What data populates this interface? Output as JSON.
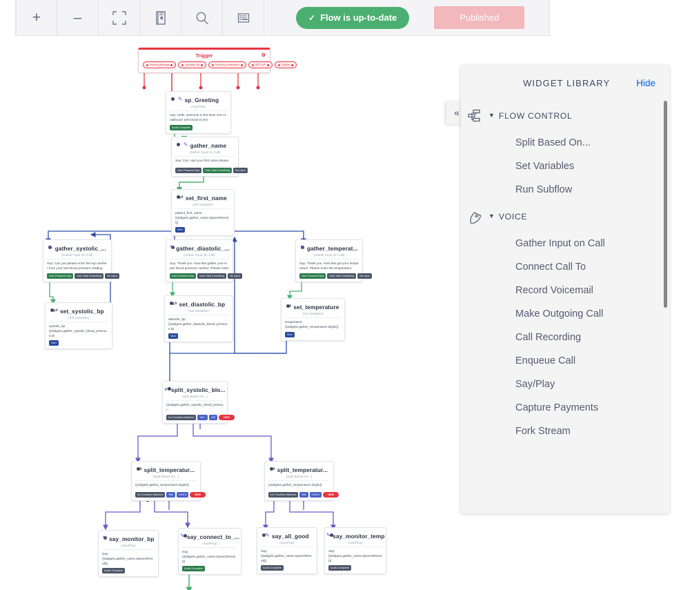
{
  "toolbar": {
    "buttons": [
      {
        "name": "zoom-in-button",
        "glyph": "+"
      },
      {
        "name": "zoom-out-button",
        "glyph": "–"
      },
      {
        "name": "fit-to-screen-button",
        "glyph": "crop"
      },
      {
        "name": "library-toggle-button",
        "glyph": "book"
      },
      {
        "name": "search-button",
        "glyph": "search"
      },
      {
        "name": "grid-button",
        "glyph": "grid"
      }
    ],
    "status_label": "Flow is up-to-date",
    "status_check": "✓",
    "status_color": "#4caf72",
    "publish_label": "Published",
    "publish_color": "#f2b8bc"
  },
  "widget_library": {
    "title": "WIDGET LIBRARY",
    "hide_label": "Hide",
    "collapse_glyph": "«",
    "groups": [
      {
        "label": "FLOW CONTROL",
        "icon": "flow-control-icon",
        "caret": "▼",
        "items": [
          "Split Based On...",
          "Set Variables",
          "Run Subflow"
        ]
      },
      {
        "label": "VOICE",
        "icon": "phone-icon",
        "caret": "▼",
        "items": [
          "Gather Input on Call",
          "Connect Call To",
          "Record Voicemail",
          "Make Outgoing Call",
          "Call Recording",
          "Enqueue Call",
          "Say/Play",
          "Capture Payments",
          "Fork Stream"
        ]
      }
    ]
  },
  "trigger": {
    "title": "Trigger",
    "gear": "⚙",
    "pills": [
      "Incoming Message",
      "Incoming Call",
      "Incoming Conversation",
      "REST API",
      "Subflow"
    ]
  },
  "nodes": [
    {
      "id": "sp_Greeting",
      "title": "sp_Greeting",
      "subtitle": "(Say/Play)",
      "icon": "say-play-icon",
      "body": "Say: Hello, welcome to the Next Gen Healthcare self check-in line",
      "ports": [
        {
          "label": "Audio Complete",
          "color": "green"
        }
      ]
    },
    {
      "id": "gather_name",
      "title": "gather_name",
      "subtitle": "(Gather Input On Call)",
      "icon": "gather-icon",
      "body": "Say: Can I get your first name please",
      "ports": [
        {
          "label": "User Pressed Keys",
          "color": "grey"
        },
        {
          "label": "User Said Something",
          "color": "green"
        },
        {
          "label": "No Input",
          "color": "grey"
        }
      ]
    },
    {
      "id": "set_first_name",
      "title": "set_first_name",
      "subtitle": "(Set Variables)",
      "icon": "set-variables-icon",
      "body": "patient_first_name\n{{widgets.gather_name.SpeechResult}}",
      "ports": [
        {
          "label": "Next",
          "color": "navy"
        }
      ]
    },
    {
      "id": "gather_systolic",
      "title": "gather_systolic_...",
      "subtitle": "(Gather Input On Call)",
      "icon": "gather-icon",
      "body": "Say: Can you please enter the top number from your last blood pressure reading",
      "ports": [
        {
          "label": "User Pressed Keys",
          "color": "green"
        },
        {
          "label": "User Said Something",
          "color": "grey"
        },
        {
          "label": "No Input",
          "color": "grey"
        }
      ]
    },
    {
      "id": "gather_diastolic",
      "title": "gather_diastolic_...",
      "subtitle": "(Gather Input On Call)",
      "icon": "gather-icon",
      "body": "Say: Thank you. Now lets gather your lower blood pressure number. Please enter",
      "ports": [
        {
          "label": "User Pressed Keys",
          "color": "green"
        },
        {
          "label": "User Said Something",
          "color": "grey"
        },
        {
          "label": "No Input",
          "color": "grey"
        }
      ]
    },
    {
      "id": "gather_temperature",
      "title": "gather_temperat...",
      "subtitle": "(Gather Input On Call)",
      "icon": "gather-icon",
      "body": "Say: Thank you. Now lets get your temperature. Please enter the temperature",
      "ports": [
        {
          "label": "User Pressed Keys",
          "color": "green"
        },
        {
          "label": "User Said Something",
          "color": "grey"
        },
        {
          "label": "No Input",
          "color": "grey"
        }
      ]
    },
    {
      "id": "set_systolic_bp",
      "title": "set_systolic_bp",
      "subtitle": "(Set Variables)",
      "icon": "set-variables-icon",
      "body": "systolic_bp\n{{widgets.gather_systolic_blood_pressure.Di",
      "ports": [
        {
          "label": "Next",
          "color": "navy"
        }
      ]
    },
    {
      "id": "set_diastolic_bp",
      "title": "set_diastolic_bp",
      "subtitle": "(Set Variables)",
      "icon": "set-variables-icon",
      "body": "diastolic_bp\n{{widgets.gather_diastolic_blood_pressure.Di",
      "ports": [
        {
          "label": "Next",
          "color": "navy"
        }
      ]
    },
    {
      "id": "set_temperature",
      "title": "set_temperature",
      "subtitle": "(Set Variables)",
      "icon": "set-variables-icon",
      "body": "temperature\n{{widgets.gather_temperature.Digits}}",
      "ports": [
        {
          "label": "Next",
          "color": "navy"
        }
      ]
    },
    {
      "id": "split_systolic",
      "title": "split_systolic_blo...",
      "subtitle": "(Split Based On...)",
      "icon": "split-icon",
      "body": "{{widgets.gather_systolic_blood_pressur...",
      "ports": [
        {
          "label": "No Condition Matches",
          "color": "grey"
        },
        {
          "label": "120..",
          "color": "blue"
        },
        {
          "label": "120",
          "color": "blue"
        },
        {
          "label": "NEW",
          "color": "red"
        }
      ]
    },
    {
      "id": "split_temperature_left",
      "title": "split_temperatur...",
      "subtitle": "(Split Based On...)",
      "icon": "split-icon",
      "body": "{{widgets.gather_temperature.Digits}}",
      "ports": [
        {
          "label": "No Condition Matches",
          "color": "grey"
        },
        {
          "label": "986",
          "color": "blue"
        },
        {
          "label": "1005.4",
          "color": "blue"
        },
        {
          "label": "NEW",
          "color": "red"
        }
      ]
    },
    {
      "id": "split_temperature_right",
      "title": "split_temperatur...",
      "subtitle": "(Split Based On...)",
      "icon": "split-icon",
      "body": "{{widgets.gather_temperature.Digits}}",
      "ports": [
        {
          "label": "No Condition Matches",
          "color": "grey"
        },
        {
          "label": "986",
          "color": "blue"
        },
        {
          "label": "1005.4",
          "color": "blue"
        },
        {
          "label": "NEW",
          "color": "red"
        }
      ]
    },
    {
      "id": "say_monitor_bp",
      "title": "say_monitor_bp",
      "subtitle": "(Say/Play)",
      "icon": "say-play-icon",
      "body": "Say:\n{{widgets.gather_name.SpeechResult}}",
      "ports": [
        {
          "label": "Audio Complete",
          "color": "grey"
        }
      ]
    },
    {
      "id": "say_connect_to",
      "title": "say_connect_to_...",
      "subtitle": "(Say/Play)",
      "icon": "say-play-icon",
      "body": "Say:\n{{widgets.gather_name.SpeechResult}}",
      "ports": [
        {
          "label": "Audio Complete",
          "color": "green"
        }
      ]
    },
    {
      "id": "say_all_good",
      "title": "say_all_good",
      "subtitle": "(Say/Play)",
      "icon": "say-play-icon",
      "body": "Say:\n{{widgets.gather_name.SpeechResult}}",
      "ports": [
        {
          "label": "Audio Complete",
          "color": "grey"
        }
      ]
    },
    {
      "id": "say_monitor_temp",
      "title": "say_monitor_temp",
      "subtitle": "(Say/Play)",
      "icon": "say-play-icon",
      "body": "Say:\n{{widgets.gather_name.SpeechResult}}",
      "ports": [
        {
          "label": "Audio Complete",
          "color": "grey"
        }
      ]
    }
  ]
}
